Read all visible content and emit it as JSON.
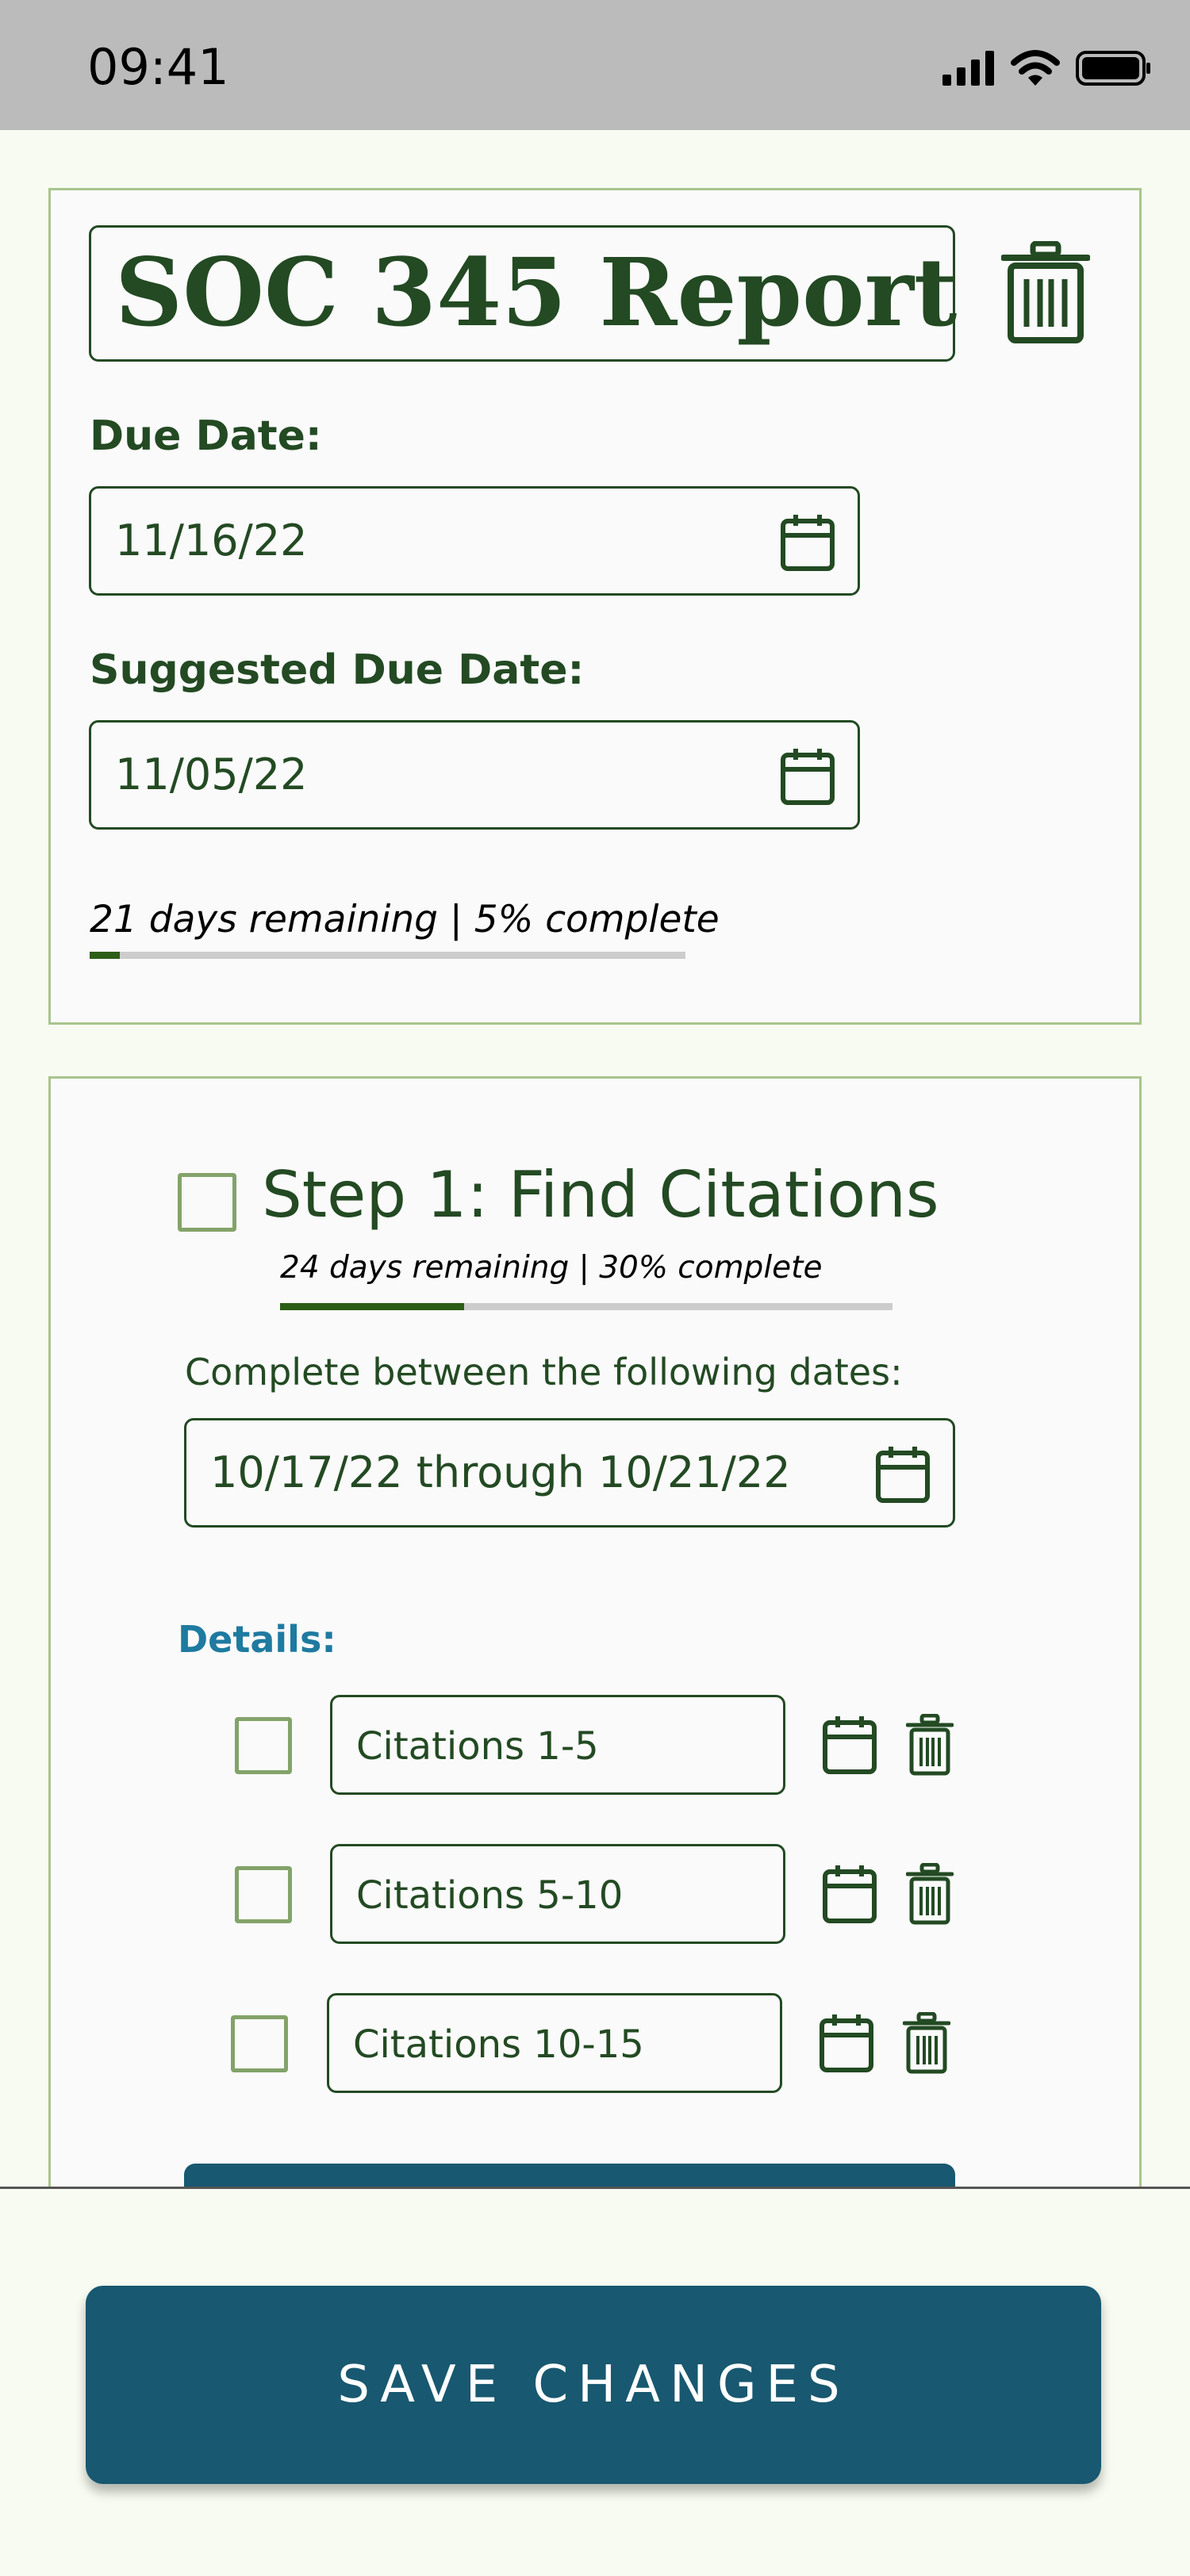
{
  "status_bar": {
    "time": "09:41",
    "icons": [
      "signal-icon",
      "wifi-icon",
      "battery-icon"
    ]
  },
  "assignment": {
    "title": "SOC 345 Report",
    "due_date_label": "Due Date:",
    "due_date": "11/16/22",
    "suggested_due_date_label": "Suggested Due Date:",
    "suggested_due_date": "11/05/22",
    "progress_text": "21 days remaining | 5% complete",
    "progress_fraction": 0.05
  },
  "step": {
    "title": "Step 1: Find Citations",
    "checked": false,
    "progress_text": "24 days remaining | 30% complete",
    "progress_fraction": 0.3,
    "range_label": "Complete between the following dates:",
    "range_value": "10/17/22 through 10/21/22",
    "details_label": "Details:",
    "details": [
      {
        "label": "Citations 1-5",
        "checked": false
      },
      {
        "label": "Citations 5-10",
        "checked": false
      },
      {
        "label": "Citations 10-15",
        "checked": false
      }
    ]
  },
  "save_button": {
    "label": "SAVE CHANGES"
  },
  "colors": {
    "primary_green": "#234a23",
    "accent_teal": "#185870",
    "details_blue": "#1e7aa0",
    "card_border": "#a9c48e",
    "checkbox_green": "#83a36a",
    "progress_fill": "#2c5e18"
  }
}
